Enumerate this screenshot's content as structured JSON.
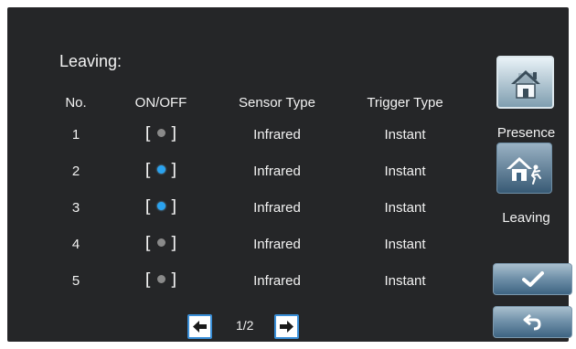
{
  "section_title": "Leaving:",
  "table": {
    "headers": [
      "No.",
      "ON/OFF",
      "Sensor Type",
      "Trigger Type"
    ],
    "rows": [
      {
        "no": "1",
        "on": false,
        "sensor": "Infrared",
        "trigger": "Instant"
      },
      {
        "no": "2",
        "on": true,
        "sensor": "Infrared",
        "trigger": "Instant"
      },
      {
        "no": "3",
        "on": true,
        "sensor": "Infrared",
        "trigger": "Instant"
      },
      {
        "no": "4",
        "on": false,
        "sensor": "Infrared",
        "trigger": "Instant"
      },
      {
        "no": "5",
        "on": false,
        "sensor": "Infrared",
        "trigger": "Instant"
      }
    ]
  },
  "sidebar": {
    "presence": {
      "label": "Presence",
      "icon": "home-icon",
      "selected": true
    },
    "leaving": {
      "label": "Leaving",
      "icon": "leaving-home-icon",
      "selected": false
    }
  },
  "actions": {
    "confirm_icon": "checkmark-icon",
    "back_icon": "back-arrow-icon"
  },
  "pagination": {
    "indicator": "1/2",
    "prev_icon": "arrow-left-icon",
    "next_icon": "arrow-right-icon"
  },
  "colors": {
    "background": "#252628",
    "toggle_on": "#2aa3f0",
    "toggle_off": "#8a8a8a",
    "accent": "#3a8fd8"
  }
}
